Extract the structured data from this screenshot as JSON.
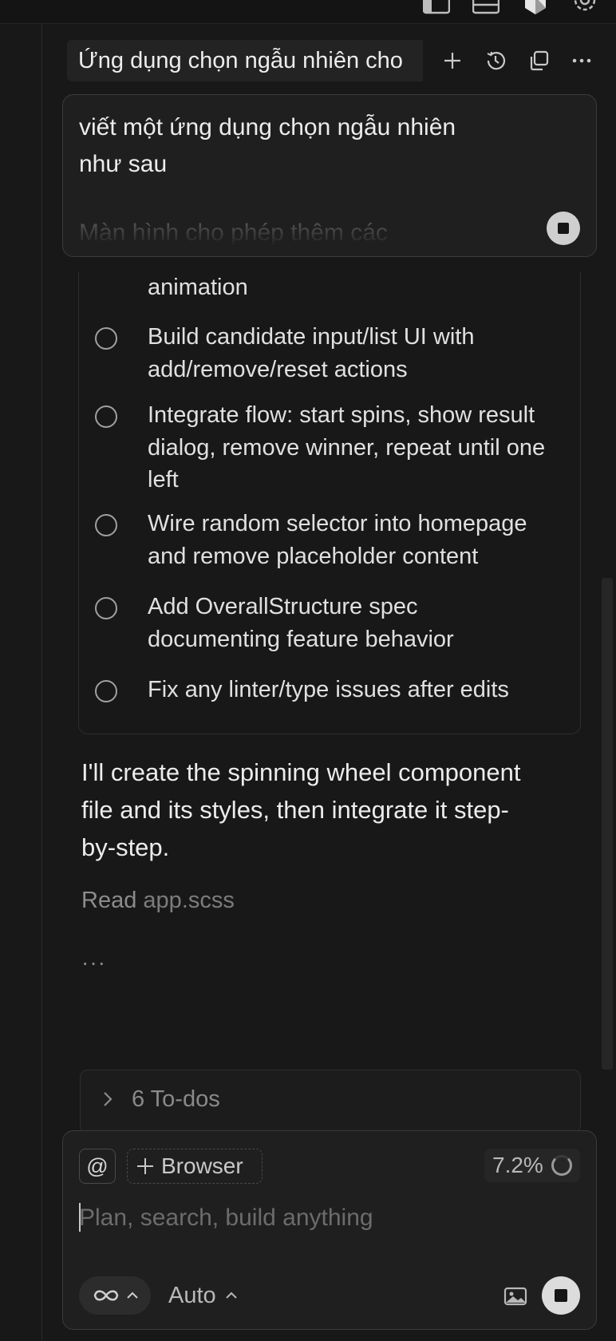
{
  "header": {
    "tab_title": "Ứng dụng chọn ngẫu nhiên cho",
    "icons": [
      "plus-icon",
      "history-icon",
      "duplicate-icon",
      "more-icon"
    ]
  },
  "prompt": {
    "line1": "viết một ứng dụng chọn ngẫu nhiên",
    "line2": "như sau",
    "faded": "Màn hình cho phép thêm các"
  },
  "todos": {
    "partial_item": "animation",
    "items": [
      {
        "text_line1": "Build candidate input/list UI with",
        "text_line2": "add/remove/reset actions",
        "text_line3": ""
      },
      {
        "text_line1": "Integrate flow: start spins, show result",
        "text_line2": "dialog, remove winner, repeat until one",
        "text_line3": "left"
      },
      {
        "text_line1": "Wire random selector into homepage",
        "text_line2": "and remove placeholder content",
        "text_line3": ""
      },
      {
        "text_line1": "Add OverallStructure spec",
        "text_line2": "documenting feature behavior",
        "text_line3": ""
      },
      {
        "text_line1": "Fix any linter/type issues after edits",
        "text_line2": "",
        "text_line3": ""
      }
    ]
  },
  "assistant": {
    "message_line1": "I'll create the spinning wheel component",
    "message_line2": "file and its styles, then integrate it step-",
    "message_line3": "by-step.",
    "read_label": "Read",
    "read_file": "app.scss",
    "ellipsis": "···"
  },
  "todos_summary": {
    "label": "6 To-dos"
  },
  "composer": {
    "mention_label": "@",
    "browser_label": "Browser",
    "context_percent": "7.2%",
    "placeholder": "Plan, search, build anything",
    "model_label": "Auto"
  },
  "colors": {
    "background": "#181818",
    "panel": "#1f1f1f",
    "border": "#3b3b3b",
    "text": "#e4e4e4",
    "muted": "#8a8a8a"
  }
}
